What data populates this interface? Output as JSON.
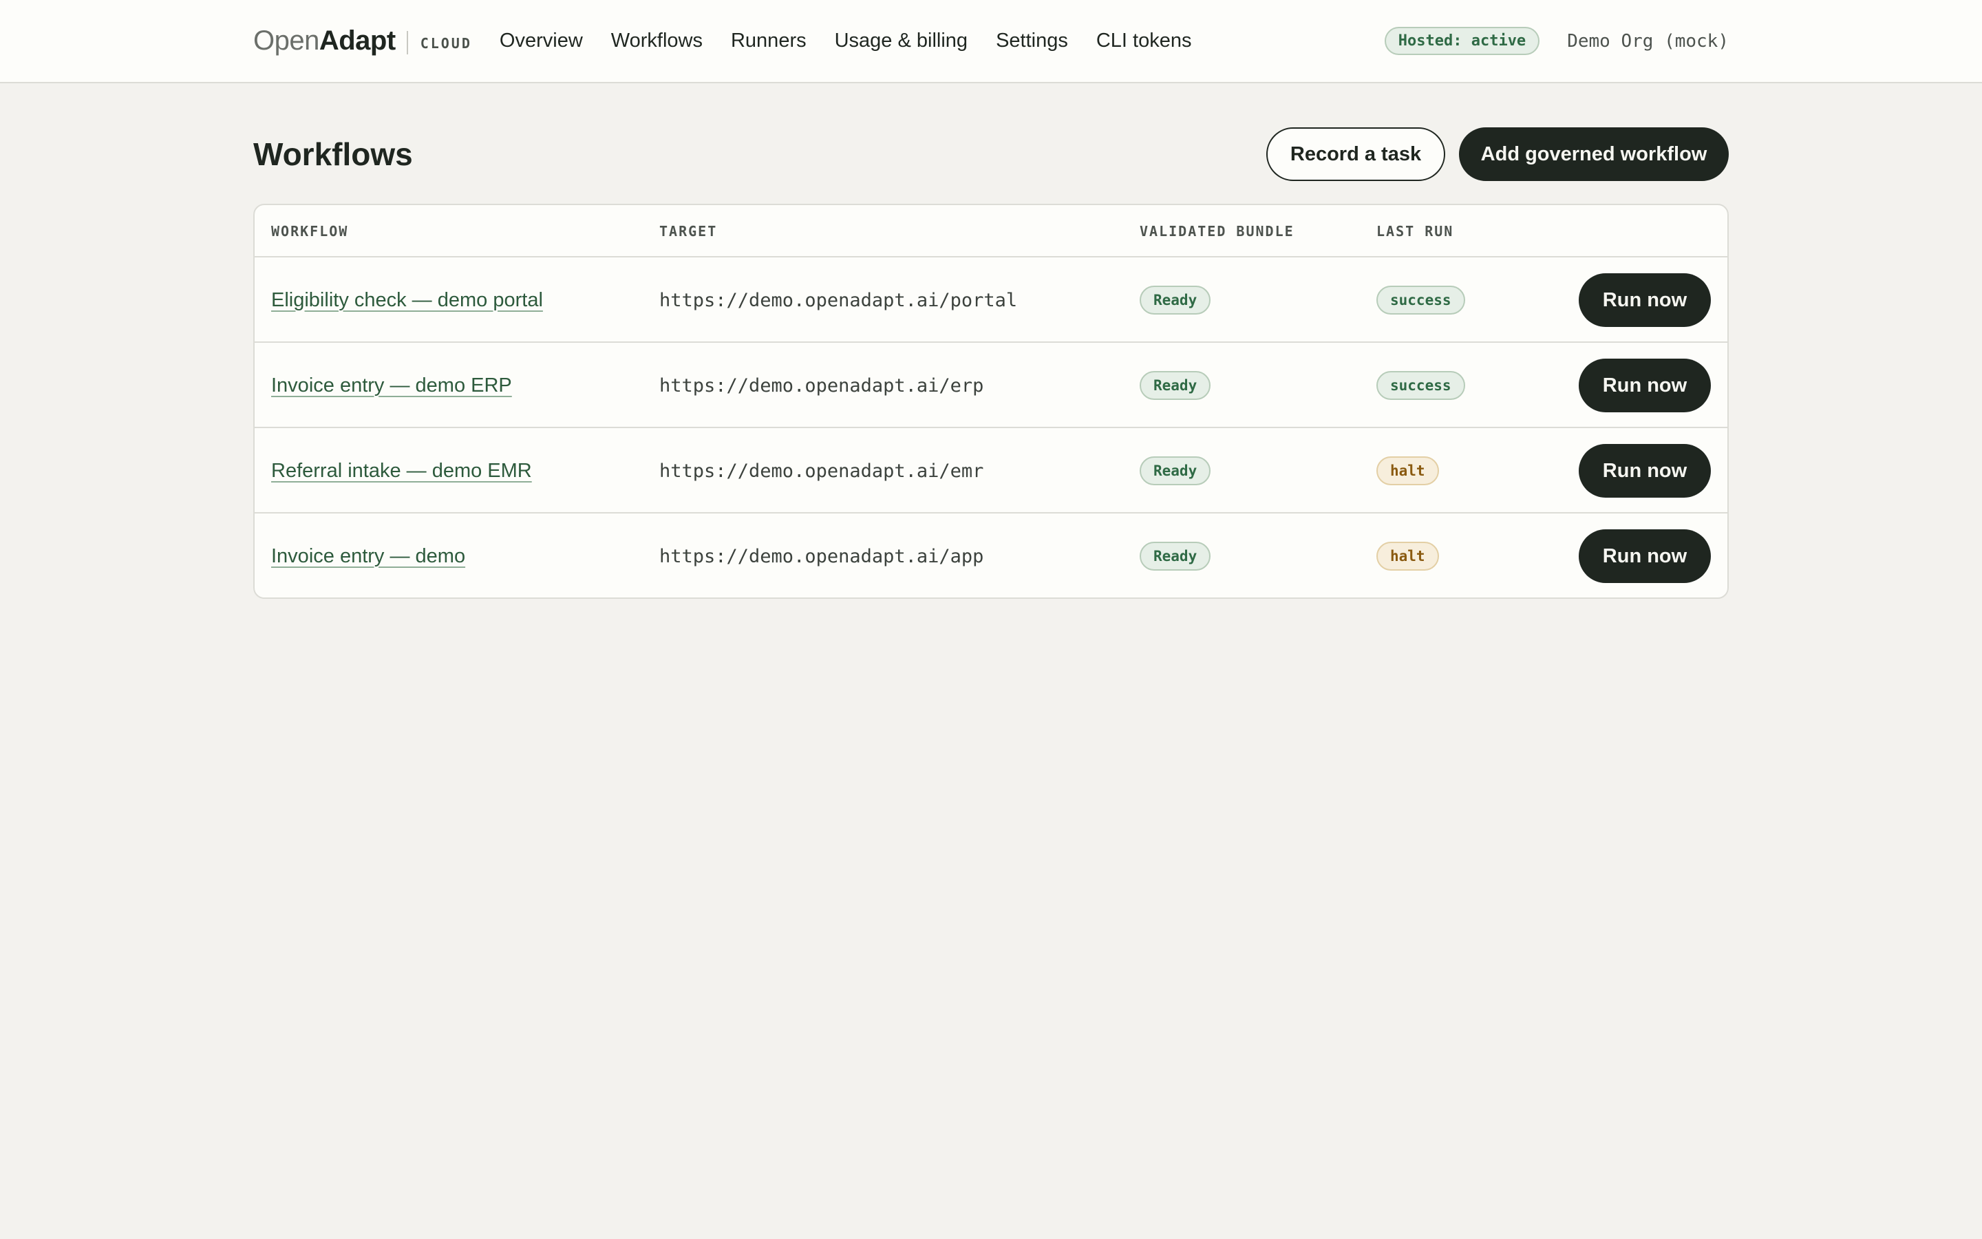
{
  "brand": {
    "open": "Open",
    "adapt": "Adapt",
    "product": "CLOUD"
  },
  "nav": {
    "items": [
      {
        "label": "Overview"
      },
      {
        "label": "Workflows"
      },
      {
        "label": "Runners"
      },
      {
        "label": "Usage & billing"
      },
      {
        "label": "Settings"
      },
      {
        "label": "CLI tokens"
      }
    ]
  },
  "status": {
    "hosted_label": "Hosted: active",
    "org_name": "Demo Org (mock)"
  },
  "page": {
    "title": "Workflows",
    "record_button": "Record a task",
    "add_button": "Add governed workflow"
  },
  "table": {
    "headers": {
      "workflow": "WORKFLOW",
      "target": "TARGET",
      "bundle": "VALIDATED BUNDLE",
      "last_run": "LAST RUN"
    },
    "rows": [
      {
        "workflow": "Eligibility check — demo portal",
        "target": "https://demo.openadapt.ai/portal",
        "bundle": "Ready",
        "last_run": "success",
        "last_run_tone": "green",
        "action": "Run now"
      },
      {
        "workflow": "Invoice entry — demo ERP",
        "target": "https://demo.openadapt.ai/erp",
        "bundle": "Ready",
        "last_run": "success",
        "last_run_tone": "green",
        "action": "Run now"
      },
      {
        "workflow": "Referral intake — demo EMR",
        "target": "https://demo.openadapt.ai/emr",
        "bundle": "Ready",
        "last_run": "halt",
        "last_run_tone": "amber",
        "action": "Run now"
      },
      {
        "workflow": "Invoice entry — demo",
        "target": "https://demo.openadapt.ai/app",
        "bundle": "Ready",
        "last_run": "halt",
        "last_run_tone": "amber",
        "action": "Run now"
      }
    ]
  }
}
